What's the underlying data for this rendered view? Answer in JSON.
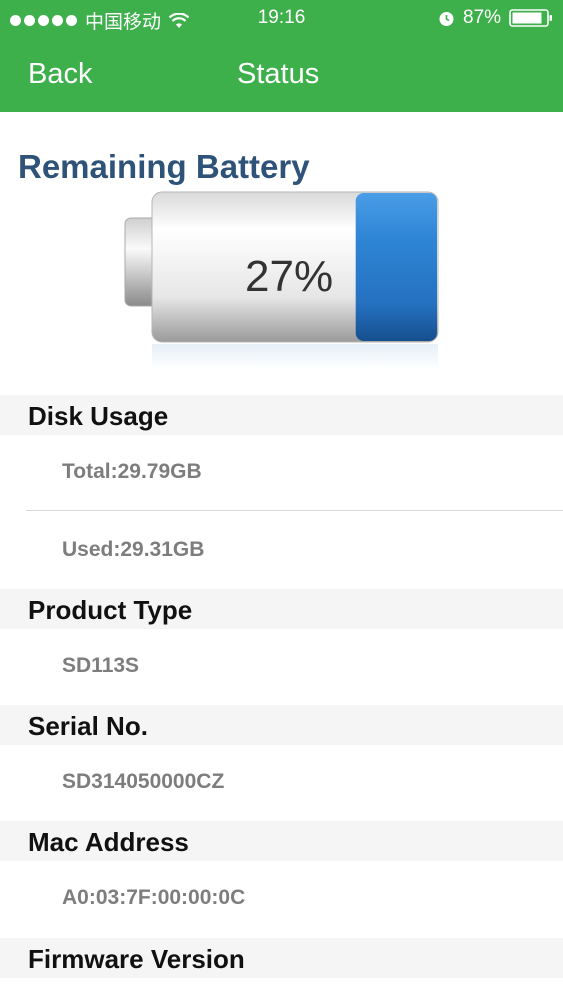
{
  "statusbar": {
    "carrier": "中国移动",
    "time": "19:16",
    "battery_percent": "87%"
  },
  "nav": {
    "back_label": "Back",
    "title": "Status"
  },
  "battery_section": {
    "title": "Remaining Battery",
    "percent_text": "27%",
    "level": 0.27,
    "fill_color": "#2d7fcf"
  },
  "disk_usage": {
    "header": "Disk Usage",
    "total": "Total:29.79GB",
    "used": "Used:29.31GB"
  },
  "product_type": {
    "header": "Product Type",
    "value": "SD113S"
  },
  "serial": {
    "header": "Serial No.",
    "value": "SD314050000CZ"
  },
  "mac": {
    "header": "Mac Address",
    "value": "A0:03:7F:00:00:0C"
  },
  "firmware": {
    "header": "Firmware Version"
  },
  "colors": {
    "accent": "#3daf4b",
    "title_color": "#2f5378"
  }
}
